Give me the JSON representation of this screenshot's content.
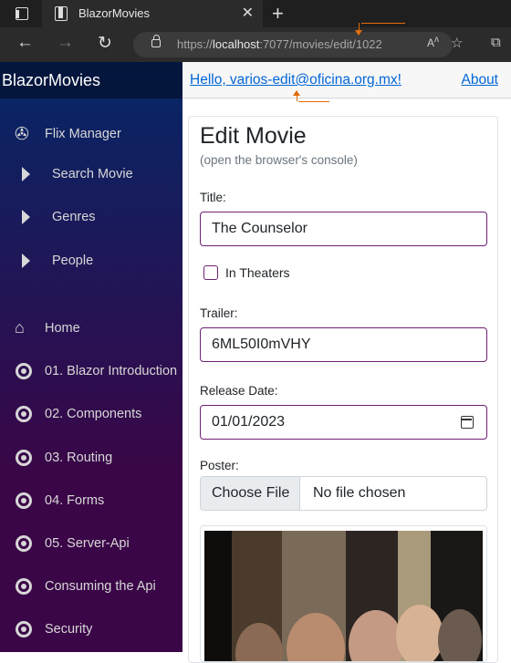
{
  "browser": {
    "tab_title": "BlazorMovies",
    "url_prefix": "https://",
    "url_host": "localhost",
    "url_rest": ":7077/movies/edit/1022",
    "new_tab": "+",
    "close": "✕"
  },
  "sidebar": {
    "brand": "BlazorMovies",
    "flix_manager": "Flix Manager",
    "sub_items": [
      "Search Movie",
      "Genres",
      "People"
    ],
    "home": "Home",
    "items": [
      "01. Blazor Introduction",
      "02. Components",
      "03. Routing",
      "04. Forms",
      "05. Server-Api",
      "Consuming the Api",
      "Security"
    ]
  },
  "topbar": {
    "hello": "Hello, varios-edit@oficina.org.mx!",
    "about": "About"
  },
  "form": {
    "heading": "Edit Movie",
    "subheading": "(open the browser's console)",
    "title_label": "Title:",
    "title_value": "The Counselor",
    "in_theaters_label": "In Theaters",
    "in_theaters_checked": false,
    "trailer_label": "Trailer:",
    "trailer_value": "6ML50I0mVHY",
    "release_label": "Release Date:",
    "release_value": "01/01/2023",
    "poster_label": "Poster:",
    "choose_file": "Choose File",
    "no_file": "No file chosen"
  },
  "colors": {
    "accent_border": "#6f1f74",
    "link": "#0366d6",
    "annotation": "#e36c09"
  }
}
